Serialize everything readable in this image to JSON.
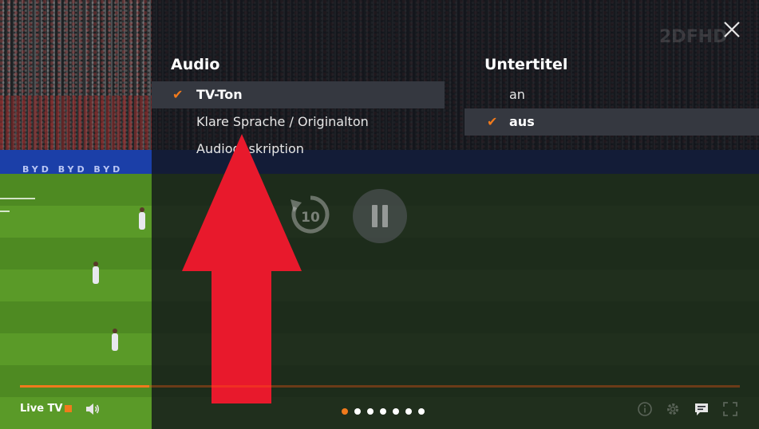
{
  "video": {
    "boards_text": "BYD  BYD  BYD"
  },
  "logo": {
    "text": "2DFHD"
  },
  "audio": {
    "title": "Audio",
    "options": [
      {
        "label": "TV-Ton",
        "selected": true
      },
      {
        "label": "Klare Sprache / Originalton",
        "selected": false
      },
      {
        "label": "Audiodeskription",
        "selected": false
      }
    ]
  },
  "subtitles": {
    "title": "Untertitel",
    "options": [
      {
        "label": "an",
        "selected": false
      },
      {
        "label": "aus",
        "selected": true
      }
    ]
  },
  "controls": {
    "replay_seconds": "10",
    "live_label": "Live TV",
    "progress_fraction": 0.18,
    "pagination": {
      "count": 7,
      "active_index": 0
    }
  },
  "colors": {
    "accent": "#f07a1c",
    "arrow": "#e8192c"
  },
  "icons": [
    "close-icon",
    "check-icon",
    "replay-10-icon",
    "pause-icon",
    "volume-icon",
    "info-icon",
    "settings-icon",
    "subtitles-icon",
    "fullscreen-icon"
  ]
}
